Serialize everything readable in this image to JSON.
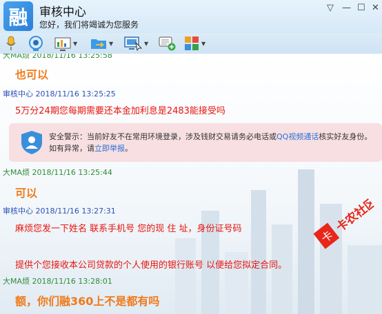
{
  "window": {
    "logo_char": "融",
    "title": "审核中心",
    "subtitle": "您好，我们将竭诚为您服务",
    "controls": [
      "▽",
      "—",
      "☐",
      "✕"
    ]
  },
  "toolbar": {
    "items": [
      {
        "icon": "microphone-icon"
      },
      {
        "icon": "webcam-icon"
      },
      {
        "icon": "screen-share-icon"
      },
      {
        "icon": "file-transfer-icon"
      },
      {
        "icon": "remote-desktop-icon"
      },
      {
        "icon": "new-chat-icon"
      },
      {
        "icon": "apps-icon"
      }
    ]
  },
  "messages": [
    {
      "sender": "大MA烦",
      "time": "2018/11/16 13:25:58",
      "text": "也可以"
    },
    {
      "sender": "审核中心",
      "time": "2018/11/16 13:25:25",
      "text": "5万分24期您每期需要还本金加利息是2483能接受吗"
    },
    {
      "sender": "大MA烦",
      "time": "2018/11/16 13:25:44",
      "text": "可以"
    },
    {
      "sender": "审核中心",
      "time": "2018/11/16 13:27:31",
      "line1": "麻烦您发一下姓名 联系手机号 您的现 住 址，身份证号码",
      "line2": "提供个您接收本公司贷款的个人使用的银行账号 以便给您拟定合同。"
    },
    {
      "sender": "大MA烦",
      "time": "2018/11/16 13:28:01",
      "text": "额，你们融360上不是都有吗"
    }
  ],
  "warning": {
    "prefix": "安全警示：当前好友不在常用环境登录，涉及钱财交易请务必电话或",
    "link1": "QQ视频通话",
    "mid": "核实好友身份。如有异常，请",
    "link2": "立即举报",
    "suffix": "。"
  },
  "watermark": {
    "text": "卡农社区"
  },
  "colors": {
    "sender_blue": "#2a4fb5",
    "sender_green": "#2f8a3a",
    "orange_text": "#f07a1a",
    "red_text": "#e8140e",
    "link": "#2b6fd6",
    "warning_bg": "#f7dfe2"
  }
}
